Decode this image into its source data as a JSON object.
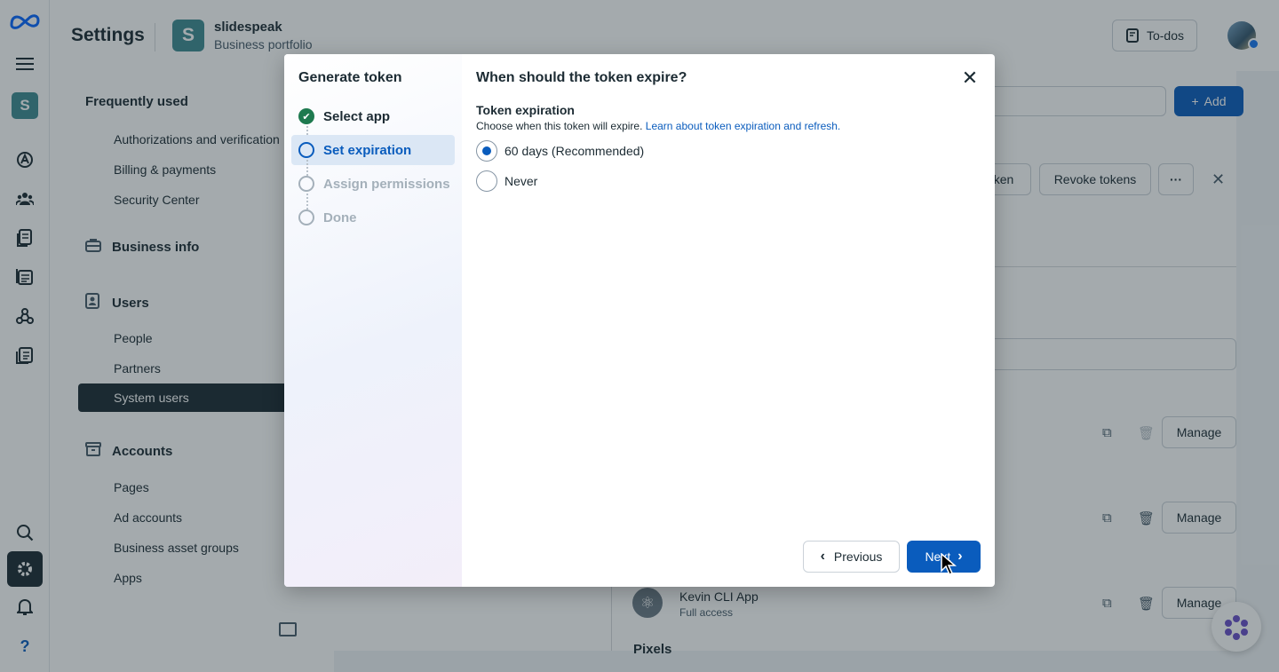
{
  "header": {
    "title": "Settings",
    "business_initial": "S",
    "business_name": "slidespeak",
    "business_sub": "Business portfolio",
    "todos_label": "To-dos"
  },
  "rail": {
    "account_initial": "S",
    "icons": [
      "meta-logo-icon",
      "menu-icon",
      "ads-icon",
      "people-icon",
      "pages-icon",
      "events-icon",
      "integrations-icon",
      "billing-icon",
      "search-icon",
      "settings-icon",
      "notifications-icon",
      "help-icon"
    ]
  },
  "sidebar": {
    "frequently_used": "Frequently used",
    "frequent_items": [
      "Authorizations and verification",
      "Billing & payments",
      "Security Center"
    ],
    "business_info": "Business info",
    "users": "Users",
    "user_items": [
      "People",
      "Partners",
      "System users"
    ],
    "accounts": "Accounts",
    "account_items": [
      "Pages",
      "Ad accounts",
      "Business asset groups",
      "Apps"
    ]
  },
  "main": {
    "add_label": "Add",
    "token_btn_partial": "ken",
    "revoke_label": "Revoke tokens",
    "more_label": "···",
    "manage_label": "Manage",
    "app_name": "Kevin CLI App",
    "app_access": "Full access",
    "pixels_label": "Pixels"
  },
  "modal": {
    "steps_title": "Generate token",
    "steps": [
      {
        "label": "Select app",
        "state": "done"
      },
      {
        "label": "Set expiration",
        "state": "current"
      },
      {
        "label": "Assign permissions",
        "state": "pending"
      },
      {
        "label": "Done",
        "state": "pending"
      }
    ],
    "title": "When should the token expire?",
    "field_label": "Token expiration",
    "help_text": "Choose when this token will expire.",
    "help_link": "Learn about token expiration and refresh.",
    "options": [
      {
        "label": "60 days (Recommended)",
        "selected": true
      },
      {
        "label": "Never",
        "selected": false
      }
    ],
    "previous_label": "Previous",
    "next_label": "Next"
  },
  "colors": {
    "primary": "#0a5cbd",
    "dark": "#1c2b33",
    "success": "#1e7a4f",
    "brand_teal": "#3f8a92"
  }
}
